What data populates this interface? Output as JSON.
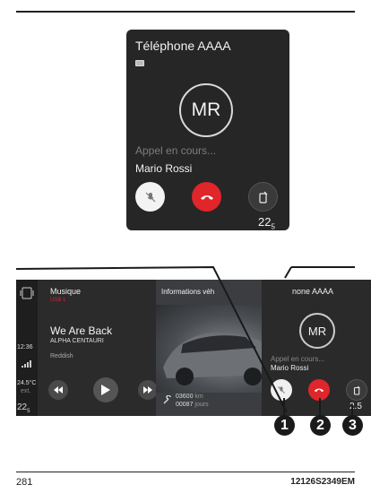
{
  "top_card": {
    "title": "Téléphone AAAA",
    "avatar_initials": "MR",
    "call_status": "Appel en cours...",
    "caller_name": "Mario Rossi",
    "temperature": "22",
    "temperature_decimal": "5"
  },
  "wide_screen": {
    "sidebar": {
      "time": "12:36",
      "outside_temp": "24.5°C",
      "outside_label": "ext.",
      "temperature": "22",
      "temperature_decimal": "5"
    },
    "music": {
      "title": "Musique",
      "source": "USB 1",
      "song": "We Are Back",
      "artist": "ALPHA CENTAURI",
      "album": "Reddish"
    },
    "vehicle_info": {
      "title": "Informations véh",
      "distance": "03600",
      "distance_unit": "km",
      "days": "00087",
      "days_unit": "jours"
    },
    "phone": {
      "title": "none AAAA",
      "avatar_initials": "MR",
      "call_status": "Appel en cours...",
      "caller_name": "Mario Rossi",
      "temperature": "2.5"
    }
  },
  "callouts": [
    "1",
    "2",
    "3"
  ],
  "footer": {
    "page_number": "281",
    "reference": "12126S2349EM"
  },
  "colors": {
    "hangup_red": "#e0252b",
    "panel_dark": "#262626",
    "source_red": "#d4243b"
  },
  "icons": [
    "battery-icon",
    "mute-mic-icon",
    "hangup-phone-icon",
    "transfer-phone-icon",
    "rewind-icon",
    "play-icon",
    "fast-forward-icon",
    "signal-icon",
    "wrench-icon",
    "screen-mirror-icon"
  ]
}
